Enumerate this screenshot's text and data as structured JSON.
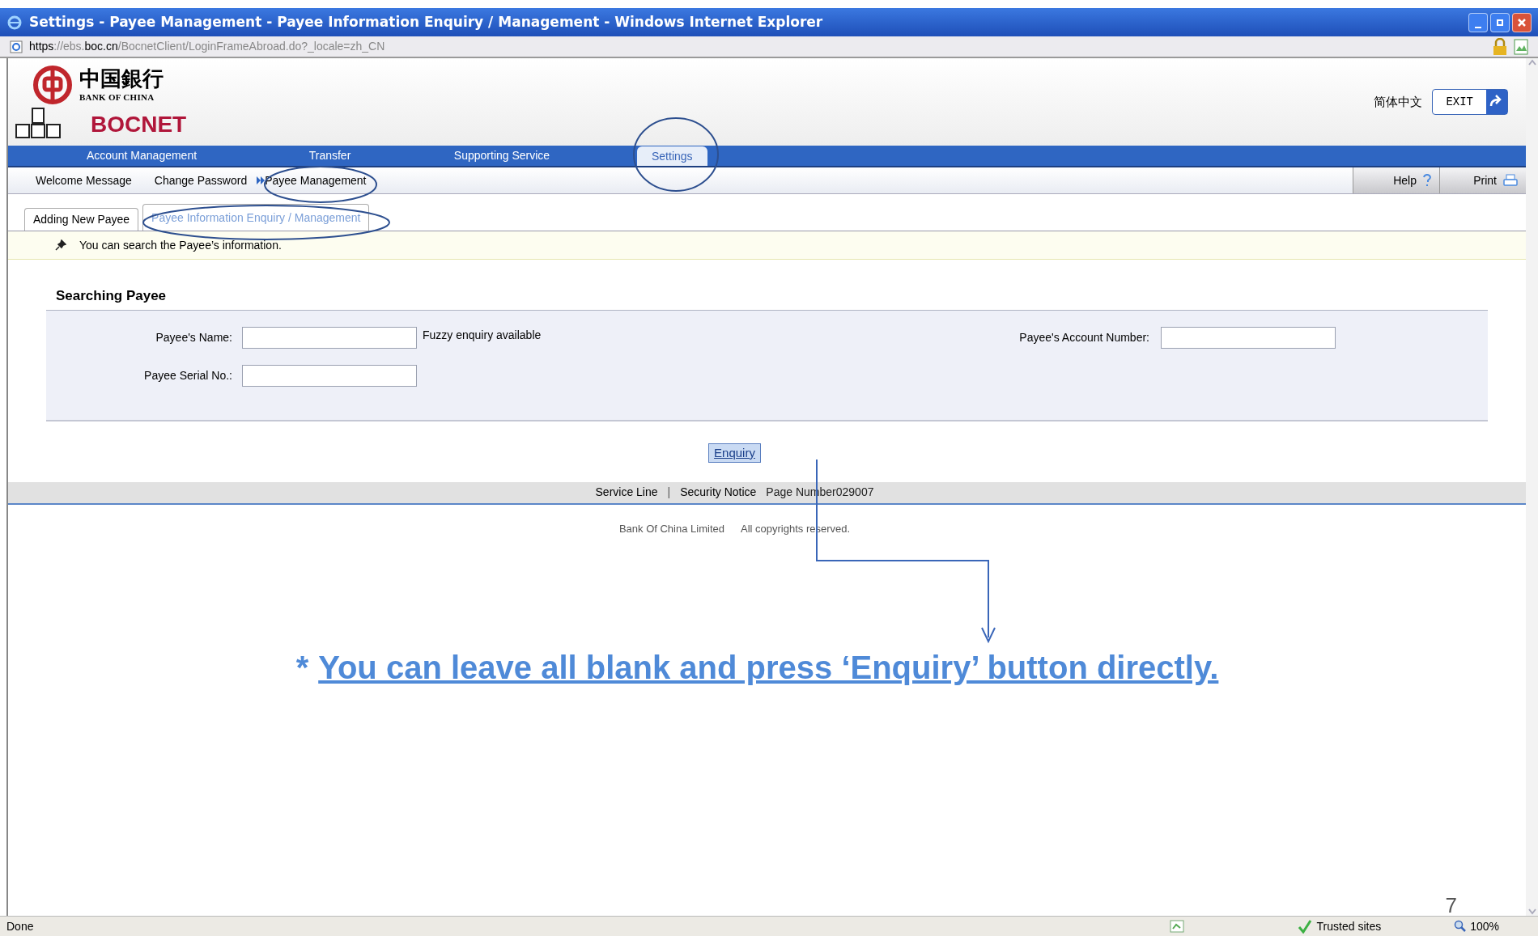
{
  "window": {
    "title": "Settings - Payee Management - Payee Information Enquiry / Management - Windows Internet Explorer"
  },
  "address_bar": {
    "url_parts": [
      {
        "text": "https",
        "strong": true
      },
      {
        "text": "://ebs.",
        "strong": false
      },
      {
        "text": "boc.cn",
        "strong": true
      },
      {
        "text": "/BocnetClient/LoginFrameAbroad.do?_locale=zh_CN",
        "strong": false
      }
    ]
  },
  "header": {
    "logo_cn": "中国銀行",
    "logo_en": "BANK OF CHINA",
    "brand": "BOCNET",
    "language": "简体中文",
    "exit_button": "EXIT"
  },
  "main_nav": [
    {
      "label": "Account Management",
      "selected": false
    },
    {
      "label": "Transfer",
      "selected": false
    },
    {
      "label": "Supporting Service",
      "selected": false
    },
    {
      "label": "Settings",
      "selected": true
    }
  ],
  "sub_nav": [
    {
      "label": "Welcome Message",
      "selected": false
    },
    {
      "label": "Change Password",
      "selected": false
    },
    {
      "label": "Payee Management",
      "selected": true
    }
  ],
  "toolbar": [
    {
      "label": "Help",
      "kind": "help"
    },
    {
      "label": "Print",
      "kind": "print"
    }
  ],
  "tabs": [
    {
      "label": "Adding New Payee",
      "selected": false
    },
    {
      "label": "Payee Information Enquiry / Management",
      "selected": true
    }
  ],
  "info": "You can search the Payee’s information.",
  "search": {
    "title": "Searching Payee",
    "fields": [
      {
        "label": "Payee's Name:",
        "hint": "Fuzzy enquiry available"
      },
      {
        "label": "Payee's Account Number:"
      },
      {
        "label": "Payee Serial No.:"
      }
    ],
    "button": "Enquiry"
  },
  "footer": {
    "links": [
      {
        "text": "Service Line",
        "kind": "link"
      },
      {
        "text": "|",
        "kind": "separator"
      },
      {
        "text": "Security Notice",
        "kind": "link"
      },
      {
        "text": "Page Number029007",
        "kind": "text"
      }
    ],
    "copyright": [
      "Bank Of China Limited",
      "All copyrights reserved."
    ]
  },
  "annotation": {
    "marker": "*",
    "text": "You can leave all blank and press ‘Enquiry’ button directly."
  },
  "slide_number": "7",
  "status_bar": {
    "status": "Done",
    "zone": "Trusted sites",
    "zoom": "100%"
  }
}
